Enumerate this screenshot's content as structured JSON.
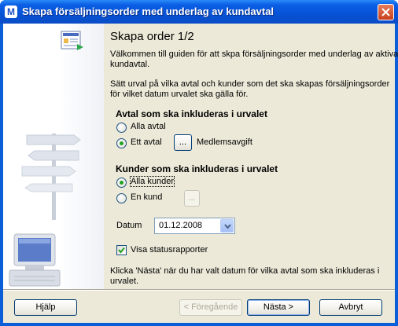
{
  "window": {
    "title": "Skapa försäljningsorder med underlag av kundavtal"
  },
  "page": {
    "heading": "Skapa order 1/2",
    "intro1": "Välkommen till guiden för att skpa försäljningsorder med underlag av aktiva",
    "intro2": "kundavtal.",
    "intro3": "Sätt urval på vilka avtal och kunder som det ska skapas försäljningsorder",
    "intro4": "för vilket datum urvalet ska gälla för."
  },
  "agreements": {
    "heading": "Avtal som ska inkluderas i urvalet",
    "option_all": "Alla avtal",
    "option_one": "Ett avtal",
    "browse_label": "...",
    "selected_value": "Medlemsavgift"
  },
  "customers": {
    "heading": "Kunder som ska inkluderas i urvalet",
    "option_all": "Alla kunder",
    "option_one": "En kund",
    "browse_label": "..."
  },
  "date": {
    "label": "Datum",
    "value": "01.12.2008"
  },
  "status": {
    "label": "Visa statusrapporter",
    "checked": true
  },
  "hint": {
    "line1": "Klicka 'Nästa' när du har valt datum för vilka avtal som ska inkluderas i",
    "line2": "urvalet."
  },
  "buttons": {
    "help": "Hjälp",
    "previous": "< Föregående",
    "next": "Nästa >",
    "cancel": "Avbryt"
  },
  "colors": {
    "titlebar": "#0653d6",
    "dialog": "#ece9d8",
    "radio_dot": "#21a121"
  }
}
